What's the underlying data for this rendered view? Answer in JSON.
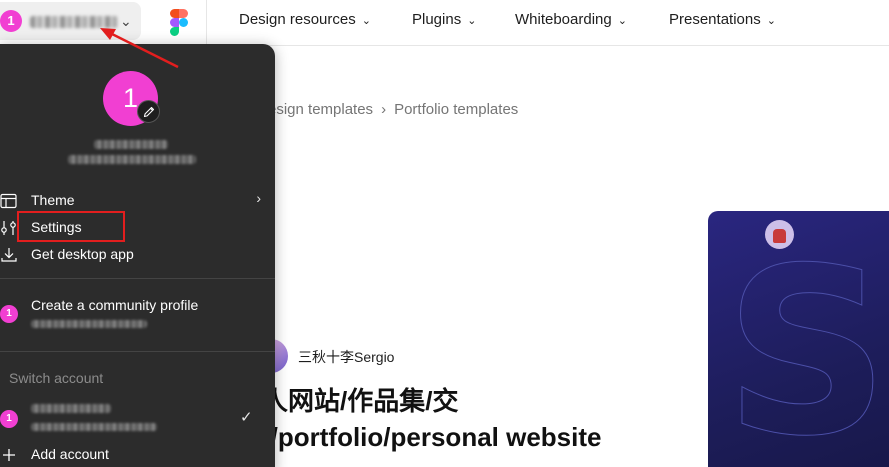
{
  "account": {
    "avatar_initial": "1"
  },
  "nav": {
    "items": [
      {
        "label": "Design resources"
      },
      {
        "label": "Plugins"
      },
      {
        "label": "Whiteboarding"
      },
      {
        "label": "Presentations"
      }
    ],
    "chevron": "⌄"
  },
  "breadcrumb": {
    "items": [
      "esign templates",
      "Portfolio templates"
    ],
    "separator": "›"
  },
  "content": {
    "author": "三秋十李Sergio",
    "title_lines": [
      "人网站/作品集/交",
      "(/portfolio/personal website"
    ]
  },
  "menu": {
    "theme": "Theme",
    "settings": "Settings",
    "desktop": "Get desktop app",
    "community": "Create a community profile",
    "switch_label": "Switch account",
    "add_account": "Add account",
    "check": "✓",
    "submenu_arrow": "›"
  },
  "colors": {
    "avatar": "#f13fd2",
    "menu_bg": "#2c2c2c",
    "annotation": "#e21e1e",
    "card_bg": "#1d1d5a"
  },
  "icons": [
    "figma-logo",
    "pencil-icon",
    "theme-icon",
    "settings-sliders-icon",
    "download-icon",
    "plus-icon",
    "checkmark-icon",
    "chevron-down-icon"
  ]
}
